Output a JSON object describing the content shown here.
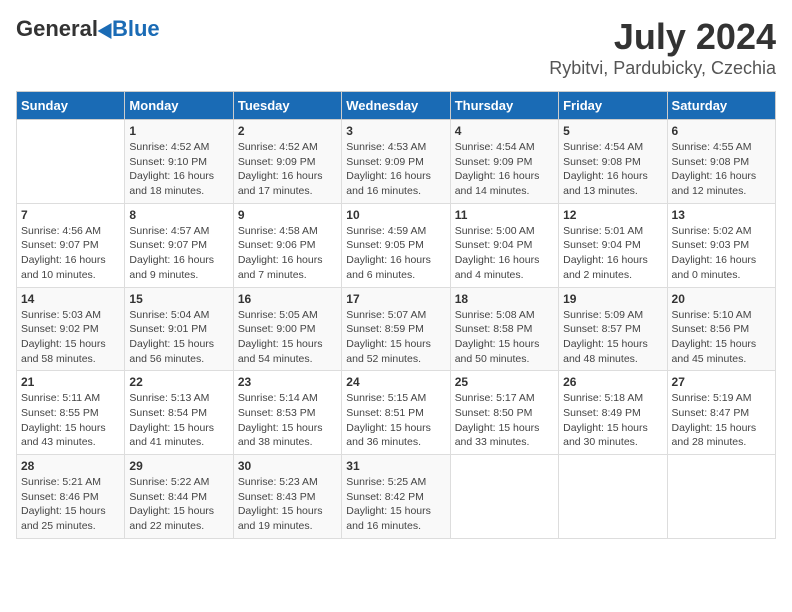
{
  "header": {
    "logo_general": "General",
    "logo_blue": "Blue",
    "title": "July 2024",
    "subtitle": "Rybitvi, Pardubicky, Czechia"
  },
  "columns": [
    "Sunday",
    "Monday",
    "Tuesday",
    "Wednesday",
    "Thursday",
    "Friday",
    "Saturday"
  ],
  "weeks": [
    [
      {
        "num": "",
        "info": ""
      },
      {
        "num": "1",
        "info": "Sunrise: 4:52 AM\nSunset: 9:10 PM\nDaylight: 16 hours\nand 18 minutes."
      },
      {
        "num": "2",
        "info": "Sunrise: 4:52 AM\nSunset: 9:09 PM\nDaylight: 16 hours\nand 17 minutes."
      },
      {
        "num": "3",
        "info": "Sunrise: 4:53 AM\nSunset: 9:09 PM\nDaylight: 16 hours\nand 16 minutes."
      },
      {
        "num": "4",
        "info": "Sunrise: 4:54 AM\nSunset: 9:09 PM\nDaylight: 16 hours\nand 14 minutes."
      },
      {
        "num": "5",
        "info": "Sunrise: 4:54 AM\nSunset: 9:08 PM\nDaylight: 16 hours\nand 13 minutes."
      },
      {
        "num": "6",
        "info": "Sunrise: 4:55 AM\nSunset: 9:08 PM\nDaylight: 16 hours\nand 12 minutes."
      }
    ],
    [
      {
        "num": "7",
        "info": "Sunrise: 4:56 AM\nSunset: 9:07 PM\nDaylight: 16 hours\nand 10 minutes."
      },
      {
        "num": "8",
        "info": "Sunrise: 4:57 AM\nSunset: 9:07 PM\nDaylight: 16 hours\nand 9 minutes."
      },
      {
        "num": "9",
        "info": "Sunrise: 4:58 AM\nSunset: 9:06 PM\nDaylight: 16 hours\nand 7 minutes."
      },
      {
        "num": "10",
        "info": "Sunrise: 4:59 AM\nSunset: 9:05 PM\nDaylight: 16 hours\nand 6 minutes."
      },
      {
        "num": "11",
        "info": "Sunrise: 5:00 AM\nSunset: 9:04 PM\nDaylight: 16 hours\nand 4 minutes."
      },
      {
        "num": "12",
        "info": "Sunrise: 5:01 AM\nSunset: 9:04 PM\nDaylight: 16 hours\nand 2 minutes."
      },
      {
        "num": "13",
        "info": "Sunrise: 5:02 AM\nSunset: 9:03 PM\nDaylight: 16 hours\nand 0 minutes."
      }
    ],
    [
      {
        "num": "14",
        "info": "Sunrise: 5:03 AM\nSunset: 9:02 PM\nDaylight: 15 hours\nand 58 minutes."
      },
      {
        "num": "15",
        "info": "Sunrise: 5:04 AM\nSunset: 9:01 PM\nDaylight: 15 hours\nand 56 minutes."
      },
      {
        "num": "16",
        "info": "Sunrise: 5:05 AM\nSunset: 9:00 PM\nDaylight: 15 hours\nand 54 minutes."
      },
      {
        "num": "17",
        "info": "Sunrise: 5:07 AM\nSunset: 8:59 PM\nDaylight: 15 hours\nand 52 minutes."
      },
      {
        "num": "18",
        "info": "Sunrise: 5:08 AM\nSunset: 8:58 PM\nDaylight: 15 hours\nand 50 minutes."
      },
      {
        "num": "19",
        "info": "Sunrise: 5:09 AM\nSunset: 8:57 PM\nDaylight: 15 hours\nand 48 minutes."
      },
      {
        "num": "20",
        "info": "Sunrise: 5:10 AM\nSunset: 8:56 PM\nDaylight: 15 hours\nand 45 minutes."
      }
    ],
    [
      {
        "num": "21",
        "info": "Sunrise: 5:11 AM\nSunset: 8:55 PM\nDaylight: 15 hours\nand 43 minutes."
      },
      {
        "num": "22",
        "info": "Sunrise: 5:13 AM\nSunset: 8:54 PM\nDaylight: 15 hours\nand 41 minutes."
      },
      {
        "num": "23",
        "info": "Sunrise: 5:14 AM\nSunset: 8:53 PM\nDaylight: 15 hours\nand 38 minutes."
      },
      {
        "num": "24",
        "info": "Sunrise: 5:15 AM\nSunset: 8:51 PM\nDaylight: 15 hours\nand 36 minutes."
      },
      {
        "num": "25",
        "info": "Sunrise: 5:17 AM\nSunset: 8:50 PM\nDaylight: 15 hours\nand 33 minutes."
      },
      {
        "num": "26",
        "info": "Sunrise: 5:18 AM\nSunset: 8:49 PM\nDaylight: 15 hours\nand 30 minutes."
      },
      {
        "num": "27",
        "info": "Sunrise: 5:19 AM\nSunset: 8:47 PM\nDaylight: 15 hours\nand 28 minutes."
      }
    ],
    [
      {
        "num": "28",
        "info": "Sunrise: 5:21 AM\nSunset: 8:46 PM\nDaylight: 15 hours\nand 25 minutes."
      },
      {
        "num": "29",
        "info": "Sunrise: 5:22 AM\nSunset: 8:44 PM\nDaylight: 15 hours\nand 22 minutes."
      },
      {
        "num": "30",
        "info": "Sunrise: 5:23 AM\nSunset: 8:43 PM\nDaylight: 15 hours\nand 19 minutes."
      },
      {
        "num": "31",
        "info": "Sunrise: 5:25 AM\nSunset: 8:42 PM\nDaylight: 15 hours\nand 16 minutes."
      },
      {
        "num": "",
        "info": ""
      },
      {
        "num": "",
        "info": ""
      },
      {
        "num": "",
        "info": ""
      }
    ]
  ]
}
